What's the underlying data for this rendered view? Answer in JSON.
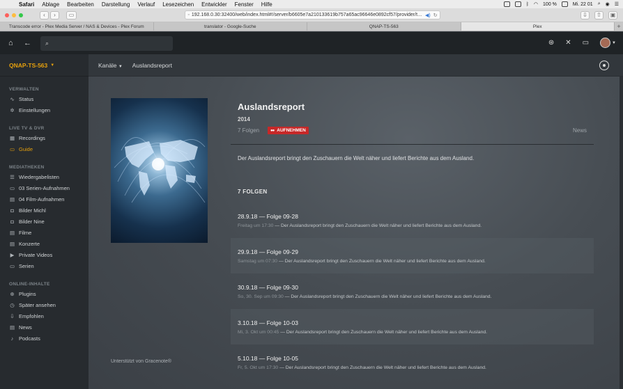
{
  "menubar": {
    "apple": "",
    "app": "Safari",
    "items": [
      "Ablage",
      "Bearbeiten",
      "Darstellung",
      "Verlauf",
      "Lesezeichen",
      "Entwickler",
      "Fenster",
      "Hilfe"
    ],
    "battery": "100 %",
    "clock": "Mi. 22 01"
  },
  "browser": {
    "url": "192.168.0.30:32400/web/index.html#!/server/b6605e7a210133619b757a65ac96646e0892cf57/provider/t…",
    "tabs": [
      "Transcode error - Plex Media Server / NAS & Devices - Plex Forum",
      "translator - Google-Suche",
      "QNAP-TS-563",
      "Plex"
    ],
    "active_tab": 3,
    "new_tab": "+"
  },
  "plex": {
    "search_placeholder": "",
    "server_name": "QNAP-TS-563",
    "crumb_channels": "Kanäle",
    "crumb_current": "Auslandsreport"
  },
  "sidebar": {
    "sections": [
      {
        "title": "VERWALTEN",
        "items": [
          {
            "label": "Status",
            "icon": "status-icon",
            "glyph": "∿"
          },
          {
            "label": "Einstellungen",
            "icon": "gear-icon",
            "glyph": "✲"
          }
        ]
      },
      {
        "title": "LIVE TV & DVR",
        "items": [
          {
            "label": "Recordings",
            "icon": "recordings-icon",
            "glyph": "▦"
          },
          {
            "label": "Guide",
            "icon": "guide-icon",
            "glyph": "▭"
          }
        ]
      },
      {
        "title": "MEDIATHEKEN",
        "items": [
          {
            "label": "Wiedergabelisten",
            "icon": "playlist-icon",
            "glyph": "☰"
          },
          {
            "label": "03 Serien-Aufnahmen",
            "icon": "tv-icon",
            "glyph": "▭"
          },
          {
            "label": "04 Film-Aufnahmen",
            "icon": "film-icon",
            "glyph": "▤"
          },
          {
            "label": "Bilder Michl",
            "icon": "camera-icon",
            "glyph": "◘"
          },
          {
            "label": "Bilder Nine",
            "icon": "camera-icon",
            "glyph": "◘"
          },
          {
            "label": "Filme",
            "icon": "film-icon",
            "glyph": "▤"
          },
          {
            "label": "Konzerte",
            "icon": "film-icon",
            "glyph": "▤"
          },
          {
            "label": "Private Videos",
            "icon": "video-icon",
            "glyph": "▶"
          },
          {
            "label": "Serien",
            "icon": "tv-icon",
            "glyph": "▭"
          }
        ]
      },
      {
        "title": "ONLINE-INHALTE",
        "items": [
          {
            "label": "Plugins",
            "icon": "plugin-icon",
            "glyph": "⊕"
          },
          {
            "label": "Später ansehen",
            "icon": "clock-icon",
            "glyph": "◷"
          },
          {
            "label": "Empfohlen",
            "icon": "recommend-icon",
            "glyph": "⇩"
          },
          {
            "label": "News",
            "icon": "news-icon",
            "glyph": "▤"
          },
          {
            "label": "Podcasts",
            "icon": "mic-icon",
            "glyph": "♪"
          }
        ]
      }
    ],
    "active_item": "Guide"
  },
  "show": {
    "title": "Auslandsreport",
    "year": "2014",
    "episode_count": "7 Folgen",
    "record_label": "AUFNEHMEN",
    "genre": "News",
    "summary": "Der Auslandsreport bringt den Zuschauern die Welt näher und liefert Berichte aus dem Ausland.",
    "episodes_heading": "7 FOLGEN",
    "gracenote": "Unterstützt von Gracenote®"
  },
  "episodes": [
    {
      "title": "28.9.18 — Folge 09-28",
      "airing": "Freitag um 17:30",
      "summary": " — Der Auslandsreport bringt den Zuschauern die Welt näher und liefert Berichte aus dem Ausland."
    },
    {
      "title": "29.9.18 — Folge 09-29",
      "airing": "Samstag um 07:30",
      "summary": " — Der Auslandsreport bringt den Zuschauern die Welt näher und liefert Berichte aus dem Ausland."
    },
    {
      "title": "30.9.18 — Folge 09-30",
      "airing": "So, 30. Sep um 09:30",
      "summary": " — Der Auslandsreport bringt den Zuschauern die Welt näher und liefert Berichte aus dem Ausland."
    },
    {
      "title": "3.10.18 — Folge 10-03",
      "airing": "Mi, 3. Okt um 00:45",
      "summary": " — Der Auslandsreport bringt den Zuschauern die Welt näher und liefert Berichte aus dem Ausland."
    },
    {
      "title": "5.10.18 — Folge 10-05",
      "airing": "Fr, 5. Okt um 17:30",
      "summary": " — Der Auslandsreport bringt den Zuschauern die Welt näher und liefert Berichte aus dem Ausland."
    }
  ],
  "colors": {
    "accent": "#e5a00d",
    "record": "#c62828",
    "close": "#fc605c",
    "minimize": "#fdbc40",
    "zoom": "#34c84a"
  }
}
